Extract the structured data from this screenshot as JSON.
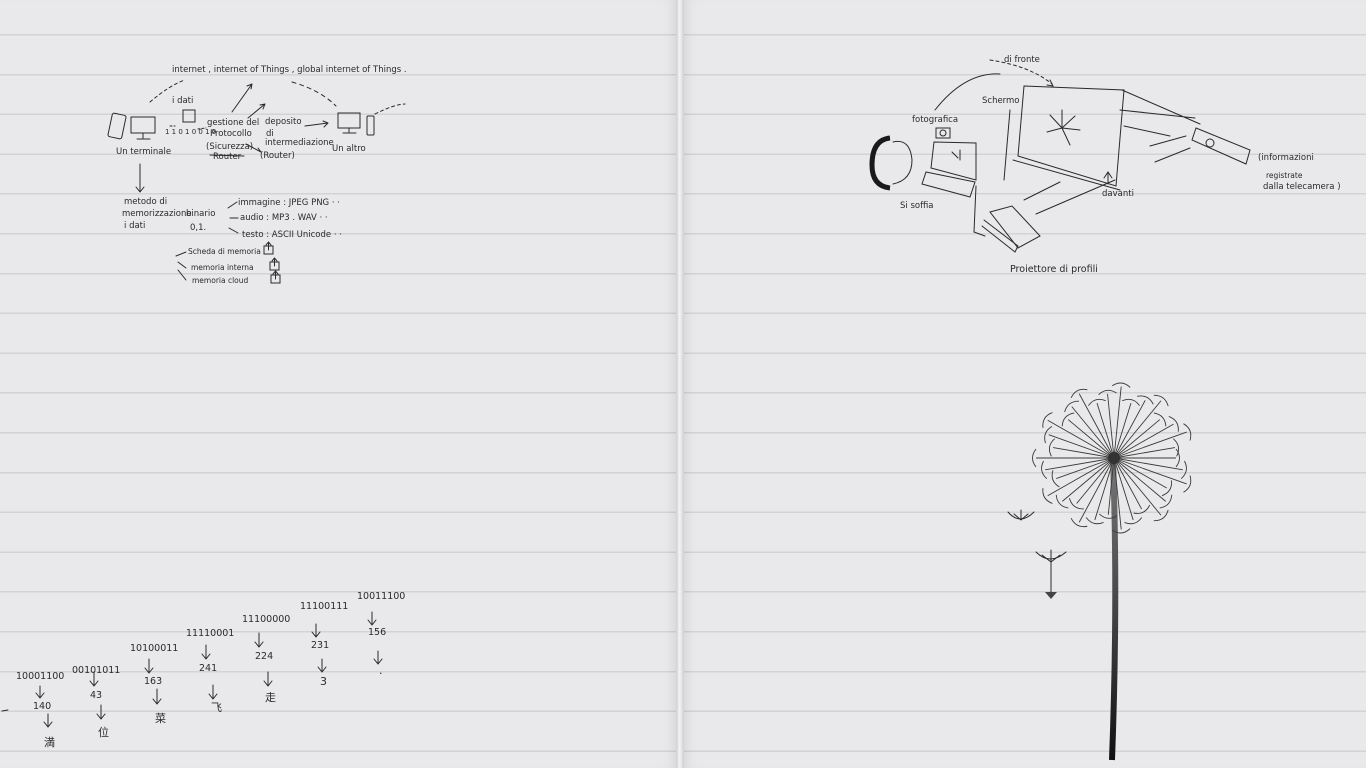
{
  "notebook": {
    "left_page": {
      "diagram_internet": {
        "top_label": "internet , internet of Things , global internet of Things .",
        "data_label": "i dati",
        "binary_stream": "1 1 0 1 0 0 1 0",
        "protocol_line1": "gestione del",
        "protocol_line2": "Protocollo",
        "protocol_line3": "(Sicurezza)",
        "protocol_line4": "Router",
        "storage_line1": "deposito",
        "storage_line2": "di",
        "storage_line3": "intermediazione",
        "storage_line4": "(Router)",
        "terminal_label": "Un terminale",
        "other_label": "Un altro",
        "memo_line1": "metodo di",
        "memo_line2": "memorizzazione",
        "memo_line3": "i dati",
        "binary_line1": "binario",
        "binary_line2": "0,1.",
        "type_image": "immagine : JPEG PNG · ·",
        "type_audio": "audio : MP3 . WAV · ·",
        "type_text": "testo : ASCII Unicode · ·",
        "mem_card": "Scheda di memoria",
        "mem_internal": "memoria interna",
        "mem_cloud": "memoria cloud"
      },
      "binary_conversion": {
        "columns": [
          {
            "binary": "10001100",
            "decimal": "140",
            "char": "満"
          },
          {
            "binary": "00101011",
            "decimal": "43",
            "char": "位"
          },
          {
            "binary": "10100011",
            "decimal": "163",
            "char": "菜"
          },
          {
            "binary": "11110001",
            "decimal": "241",
            "char": "飞"
          },
          {
            "binary": "11100000",
            "decimal": "224",
            "char": "走"
          },
          {
            "binary": "11100111",
            "decimal": "231",
            "char": "3"
          },
          {
            "binary": "10011100",
            "decimal": "156",
            "char": "·"
          }
        ]
      }
    },
    "right_page": {
      "diagram_projector": {
        "front_label": "di fronte",
        "screen_label": "Schermo",
        "photo_label": "fotografica",
        "blow_label": "Si soffia",
        "front2_label": "davanti",
        "projector_label": "Proiettore di profili",
        "info_line1": "(informazioni",
        "info_line2": "registrate",
        "info_line3": "dalla telecamera )"
      },
      "dandelion_illustration": {
        "depicts": "dandelion-with-drifting-seeds",
        "ink_color": "#3a3a3a"
      }
    }
  }
}
